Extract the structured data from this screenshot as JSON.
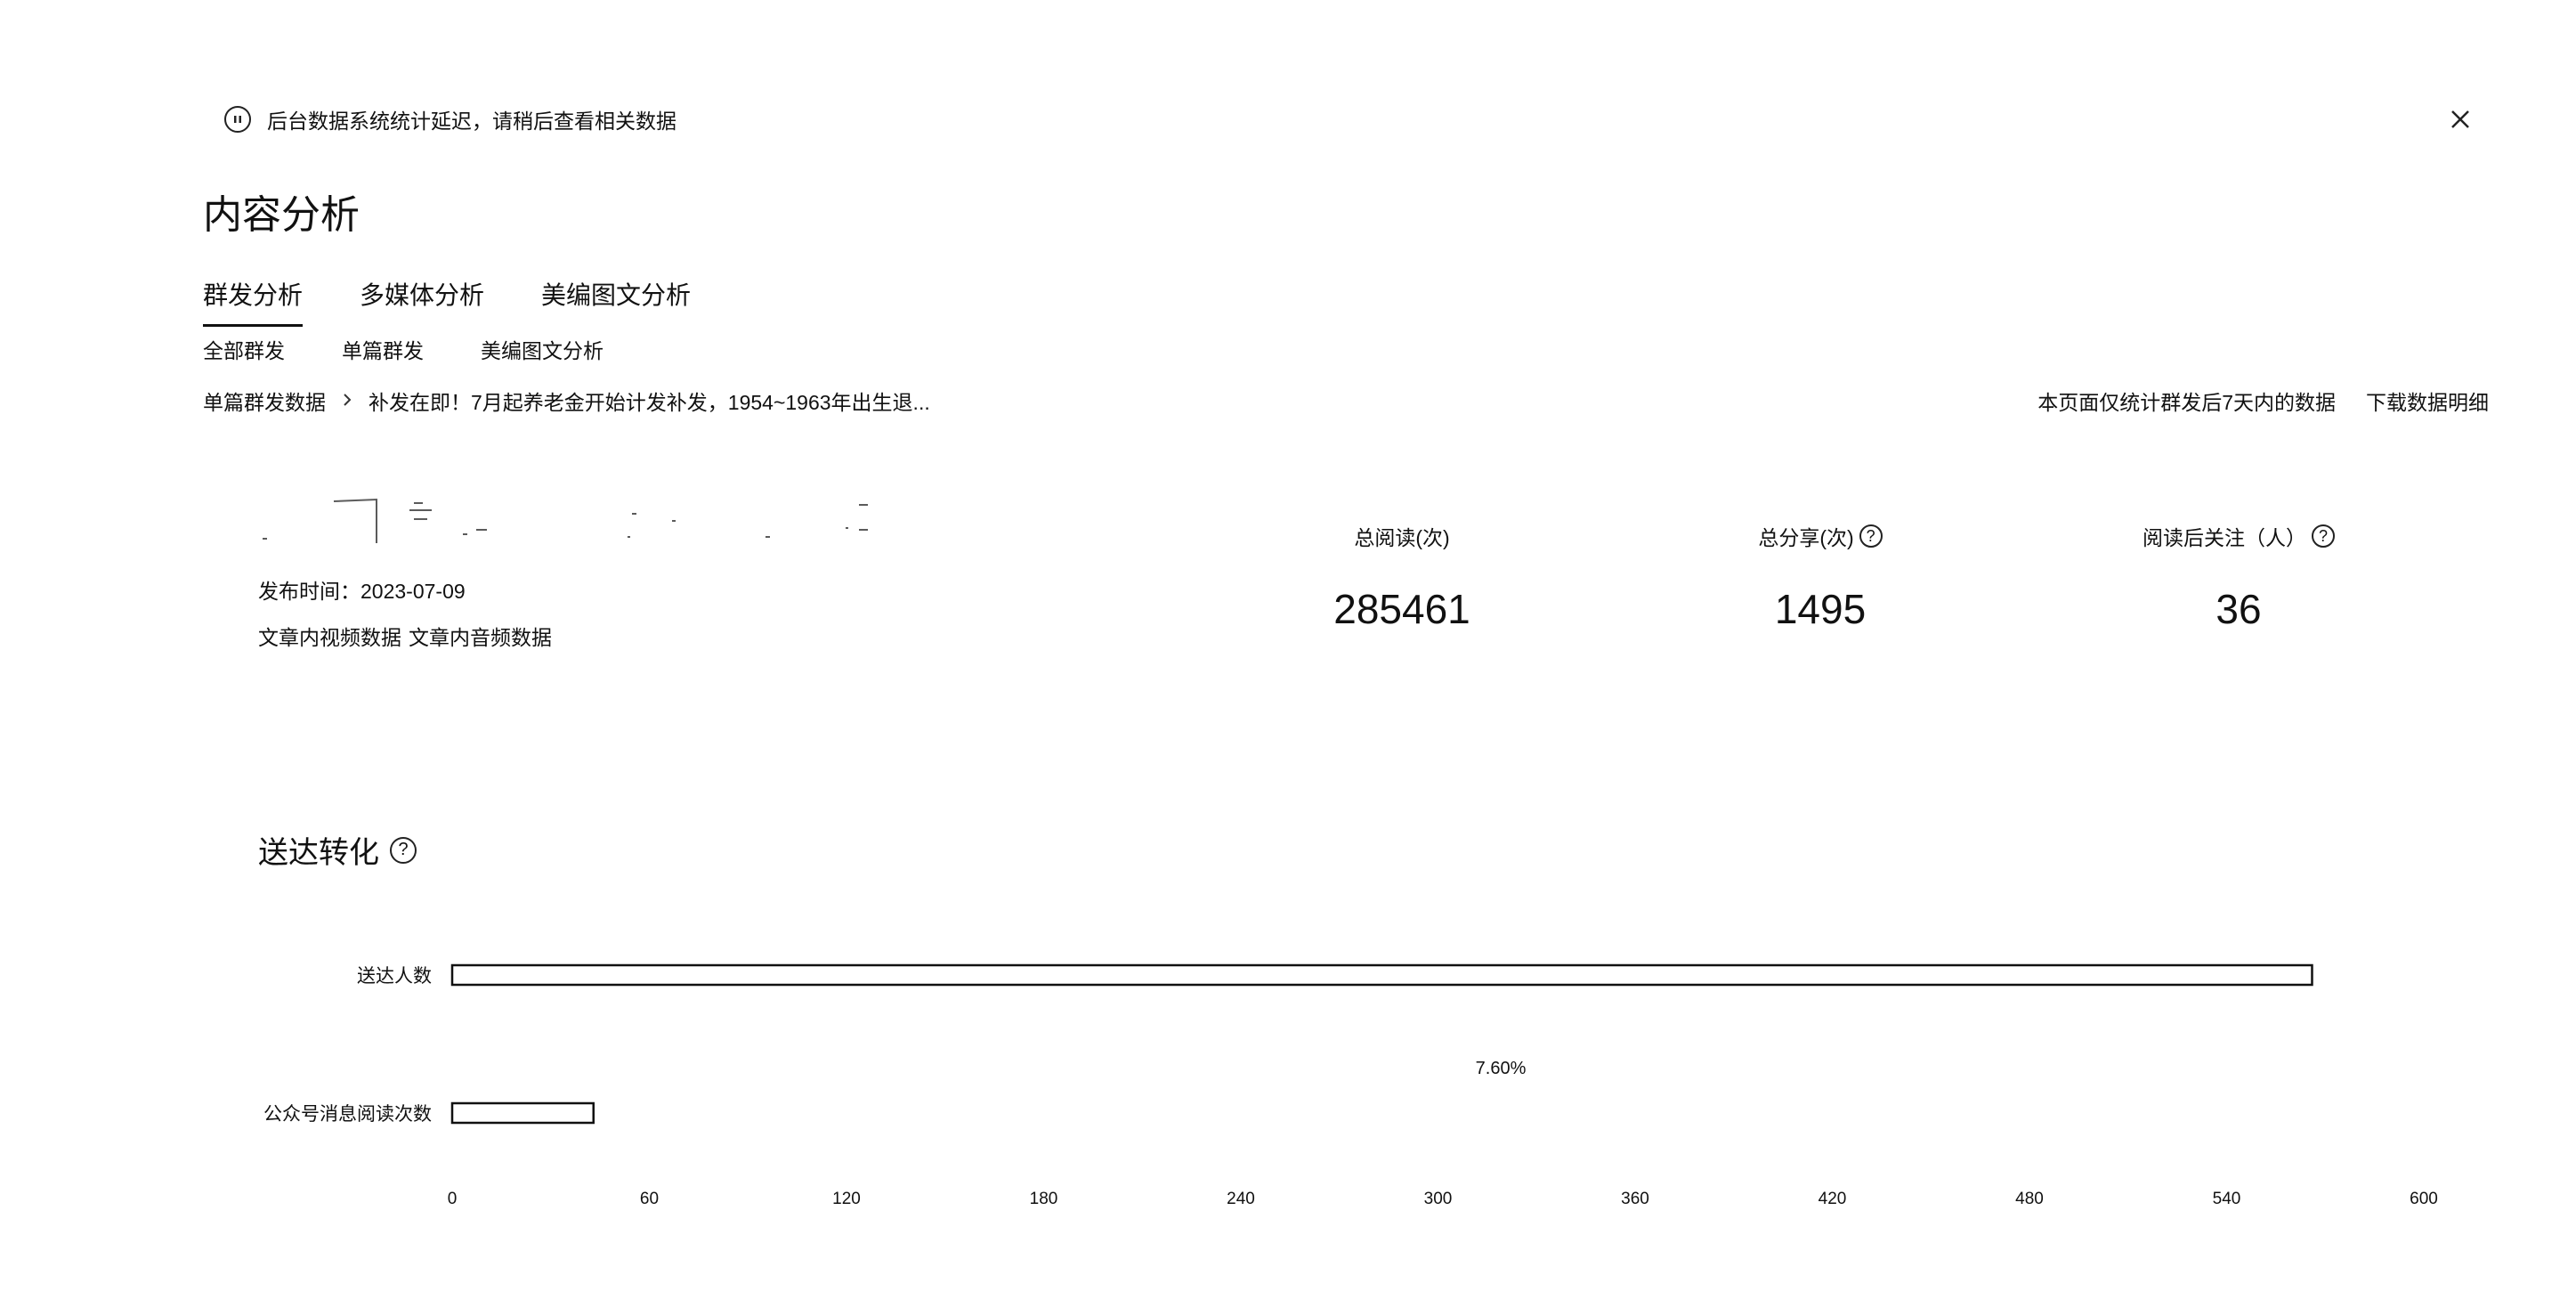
{
  "notice": {
    "text": "后台数据系统统计延迟，请稍后查看相关数据",
    "icon": "pause-circle-icon"
  },
  "page_title": "内容分析",
  "tabs": [
    {
      "label": "群发分析",
      "active": true
    },
    {
      "label": "多媒体分析",
      "active": false
    },
    {
      "label": "美编图文分析",
      "active": false
    }
  ],
  "subtabs": [
    {
      "label": "全部群发"
    },
    {
      "label": "单篇群发"
    },
    {
      "label": "美编图文分析"
    }
  ],
  "breadcrumb": {
    "root": "单篇群发数据",
    "current": "补发在即！7月起养老金开始计发补发，1954~1963年出生退..."
  },
  "right_links": {
    "note": "本页面仅统计群发后7天内的数据",
    "download": "下载数据明细"
  },
  "article": {
    "publish_time": "发布时间：2023-07-09",
    "video_data": "文章内视频数据",
    "audio_data": "文章内音频数据"
  },
  "stats": [
    {
      "label": "总阅读(次)",
      "value": "285461",
      "help": false
    },
    {
      "label": "总分享(次)",
      "value": "1495",
      "help": true
    },
    {
      "label": "阅读后关注（人）",
      "value": "36",
      "help": true
    }
  ],
  "funnel": {
    "title": "送达转化"
  },
  "chart_data": {
    "type": "bar",
    "orientation": "horizontal",
    "categories": [
      "送达人数",
      "公众号消息阅读次数"
    ],
    "values": [
      566,
      43
    ],
    "annotation": "7.60%",
    "xticks": [
      0,
      60,
      120,
      180,
      240,
      300,
      360,
      420,
      480,
      540,
      600
    ],
    "xlim": [
      0,
      600
    ],
    "grid": false
  }
}
